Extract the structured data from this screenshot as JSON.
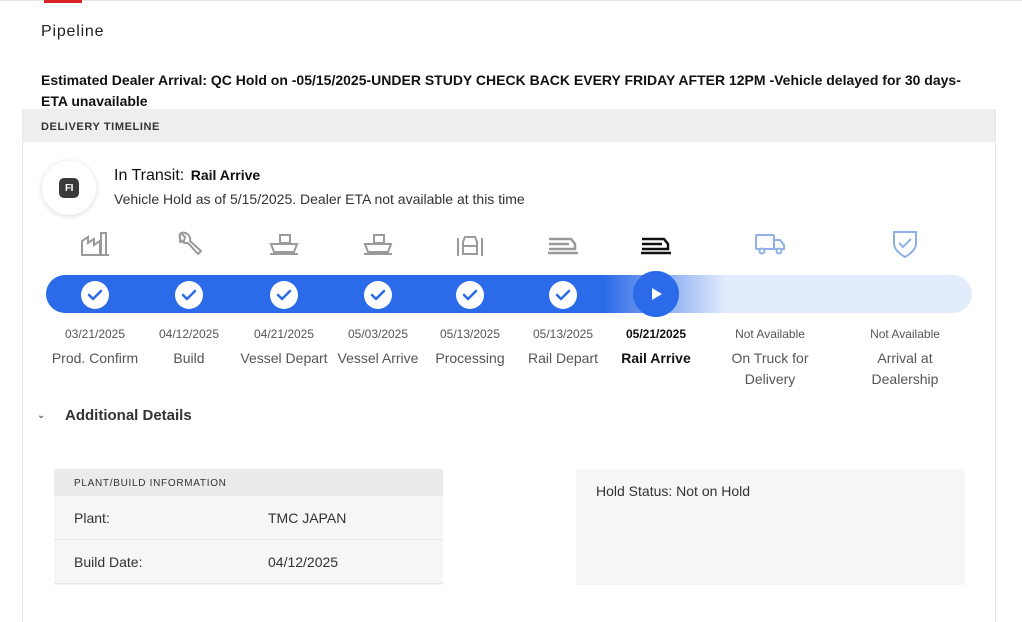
{
  "page": {
    "title": "Pipeline",
    "eta_line": "Estimated Dealer Arrival: QC Hold on -05/15/2025-UNDER STUDY CHECK BACK EVERY FRIDAY AFTER 12PM -Vehicle delayed for 30 days- ETA unavailable"
  },
  "timeline": {
    "header": "DELIVERY TIMELINE",
    "badge_text": "FI",
    "status_title": "In Transit:",
    "status_subtitle": "Rail Arrive",
    "status_desc": "Vehicle Hold as of 5/15/2025. Dealer ETA not available at this time",
    "accent_color": "#2b6ae8",
    "steps": [
      {
        "label": "Prod. Confirm",
        "date": "03/21/2025",
        "state": "complete",
        "icon": "factory-icon"
      },
      {
        "label": "Build",
        "date": "04/12/2025",
        "state": "complete",
        "icon": "wrench-icon"
      },
      {
        "label": "Vessel Depart",
        "date": "04/21/2025",
        "state": "complete",
        "icon": "ship-icon"
      },
      {
        "label": "Vessel Arrive",
        "date": "05/03/2025",
        "state": "complete",
        "icon": "ship-icon"
      },
      {
        "label": "Processing",
        "date": "05/13/2025",
        "state": "complete",
        "icon": "car-icon"
      },
      {
        "label": "Rail Depart",
        "date": "05/13/2025",
        "state": "complete",
        "icon": "rail-icon"
      },
      {
        "label": "Rail Arrive",
        "date": "05/21/2025",
        "state": "current",
        "icon": "rail-icon"
      },
      {
        "label": "On Truck for Delivery",
        "date": "Not Available",
        "state": "pending",
        "icon": "truck-icon"
      },
      {
        "label": "Arrival at Dealership",
        "date": "Not Available",
        "state": "pending",
        "icon": "shield-check-icon"
      }
    ]
  },
  "details": {
    "toggle_label": "Additional Details",
    "plant_header": "PLANT/BUILD INFORMATION",
    "plant_label": "Plant:",
    "plant_value": "TMC JAPAN",
    "build_date_label": "Build Date:",
    "build_date_value": "04/12/2025",
    "hold_status": "Hold Status: Not on Hold"
  }
}
